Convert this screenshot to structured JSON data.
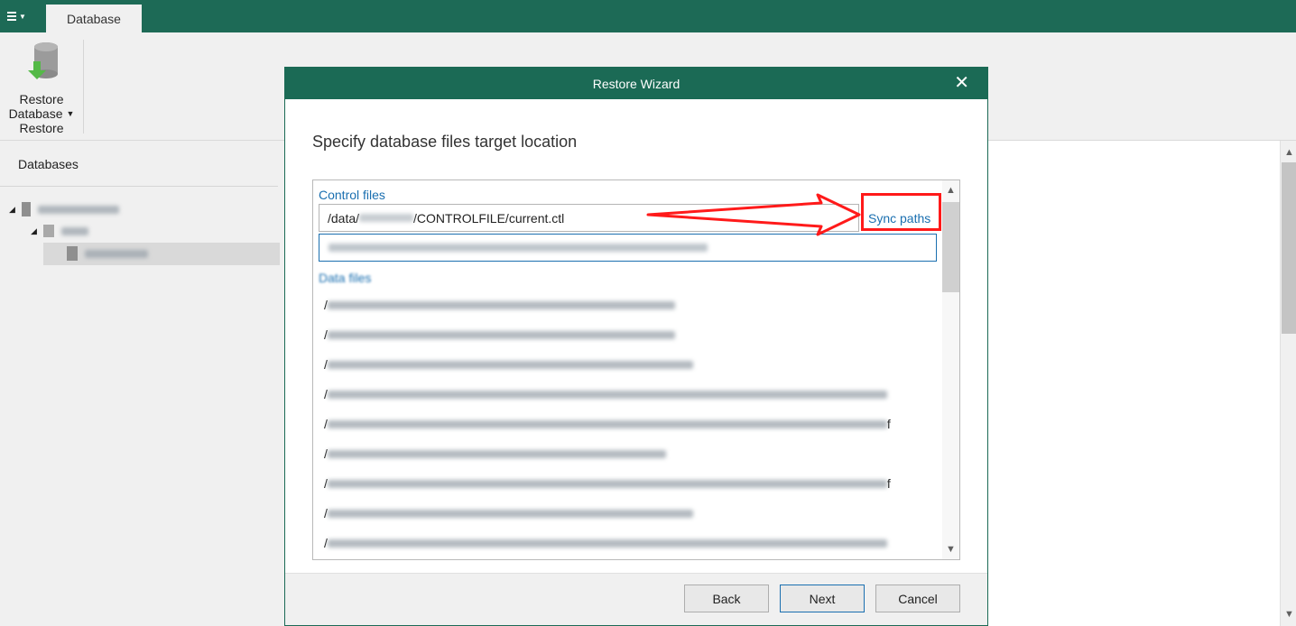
{
  "topbar": {
    "tab_label": "Database"
  },
  "ribbon": {
    "button_label_line1": "Restore",
    "button_label_line2": "Database",
    "group_label": "Restore"
  },
  "left_pane": {
    "title": "Databases"
  },
  "dialog": {
    "title": "Restore Wizard",
    "heading": "Specify database files target location",
    "control_files_label": "Control files",
    "control_file_prefix": "/data/",
    "control_file_suffix": "/CONTROLFILE/current.ctl",
    "data_files_label": "Data files",
    "sync_paths_label": "Sync paths",
    "data_rows": [
      "/",
      "/",
      "/",
      "/",
      "/",
      "/",
      "/",
      "/",
      "/"
    ],
    "data_row_suffix_5": "f",
    "data_row_suffix_7": "f",
    "back_label": "Back",
    "next_label": "Next",
    "cancel_label": "Cancel"
  },
  "colors": {
    "accent": "#1d6a56",
    "link": "#1a6fb0",
    "highlight": "#ff1a1a"
  },
  "icons": [
    "hamburger-icon",
    "database-restore-icon",
    "server-icon",
    "folder-icon",
    "database-icon",
    "close-icon",
    "scroll-up-icon",
    "scroll-down-icon"
  ]
}
